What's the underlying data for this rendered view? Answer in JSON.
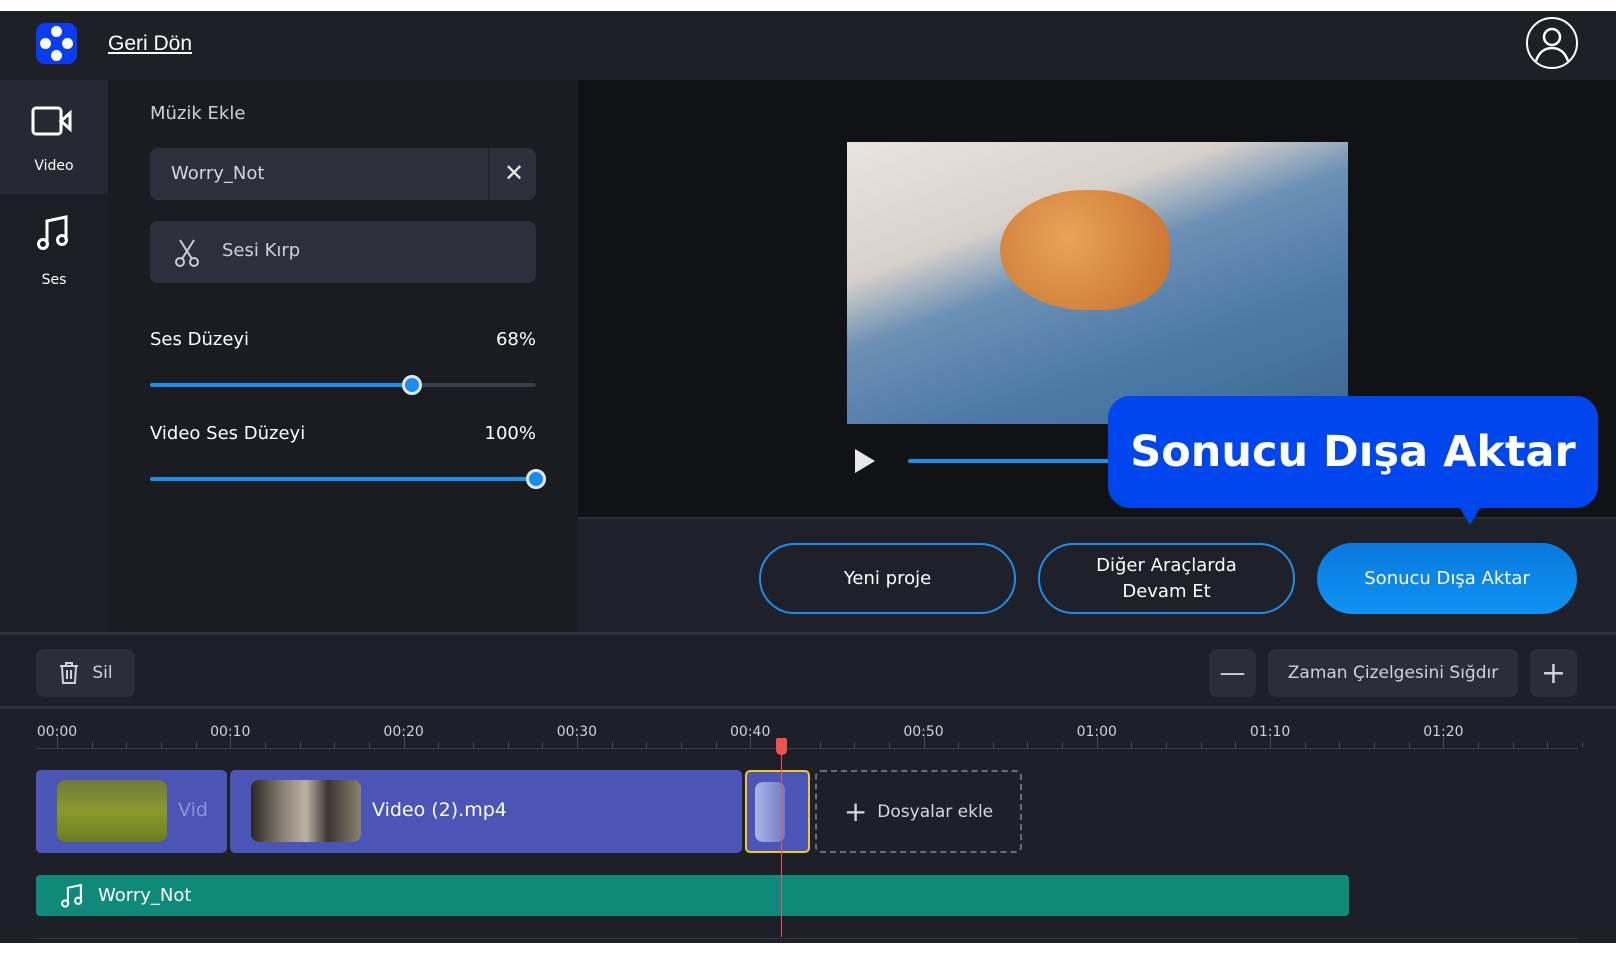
{
  "header": {
    "back_link": "Geri Dön",
    "logo": "app-logo",
    "avatar": "user-avatar-icon"
  },
  "sidebar": {
    "items": [
      {
        "label": "Video",
        "icon": "video-camera-icon",
        "active": true
      },
      {
        "label": "Ses",
        "icon": "music-note-icon",
        "active": false
      }
    ]
  },
  "panel": {
    "title": "Müzik Ekle",
    "music_value": "Worry_Not",
    "trim_label": "Sesi Kırp",
    "volume": {
      "label": "Ses Düzeyi",
      "value_text": "68%",
      "value": 68
    },
    "video_volume": {
      "label": "Video Ses Düzeyi",
      "value_text": "100%",
      "value": 100
    }
  },
  "preview": {
    "progress_percent": 40
  },
  "tooltip": "Sonucu Dışa Aktar",
  "actions": {
    "new_project": "Yeni proje",
    "continue_line1": "Diğer Araçlarda",
    "continue_line2": "Devam Et",
    "export": "Sonucu Dışa Aktar"
  },
  "timeline": {
    "delete": "Sil",
    "fit": "Zaman Çizelgesini Sığdır",
    "ruler": [
      "00:00",
      "00:10",
      "00:20",
      "00:30",
      "00:40",
      "00:50",
      "01:00",
      "01:10",
      "01:20"
    ],
    "clips": [
      {
        "label": "Vid"
      },
      {
        "label": "Video (2).mp4"
      }
    ],
    "add_files": "Dosyalar ekle",
    "audio_track": "Worry_Not",
    "accent": "#4a55b5",
    "audio_color": "#0f8a7a",
    "playhead_color": "#ef5350"
  }
}
